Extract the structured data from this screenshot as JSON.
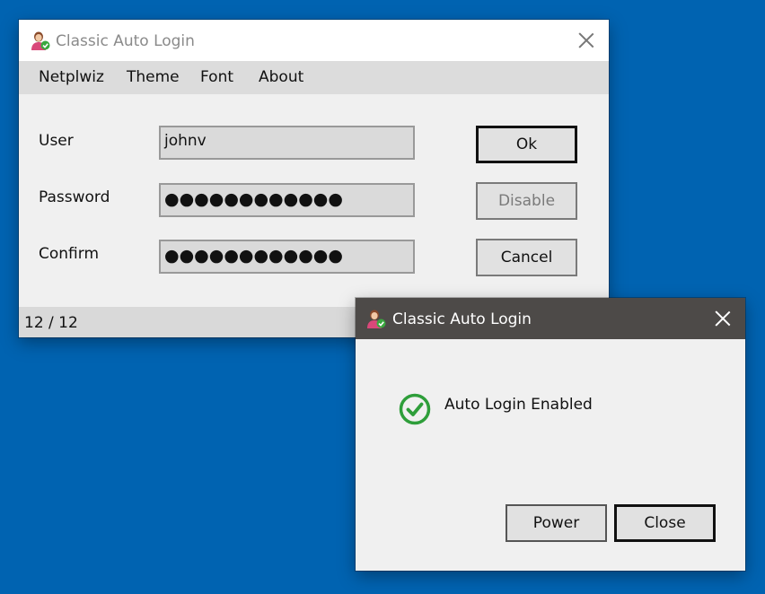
{
  "main_window": {
    "title": "Classic Auto Login",
    "menu": [
      "Netplwiz",
      "Theme",
      "Font",
      "About"
    ],
    "labels": {
      "user": "User",
      "password": "Password",
      "confirm": "Confirm"
    },
    "values": {
      "user": "johnv",
      "password": "●●●●●●●●●●●●",
      "confirm": "●●●●●●●●●●●●"
    },
    "buttons": {
      "ok": "Ok",
      "disable": "Disable",
      "cancel": "Cancel"
    },
    "status": "12 / 12"
  },
  "dialog": {
    "title": "Classic Auto Login",
    "message": "Auto Login Enabled",
    "buttons": {
      "power": "Power",
      "close": "Close"
    }
  },
  "icons": {
    "app": "user-check-icon",
    "close": "close-icon",
    "success": "checkmark-circle-icon"
  },
  "colors": {
    "desktop": "#0063b1",
    "dialog_titlebar": "#4d4a48",
    "success_green": "#2e9e3a"
  }
}
